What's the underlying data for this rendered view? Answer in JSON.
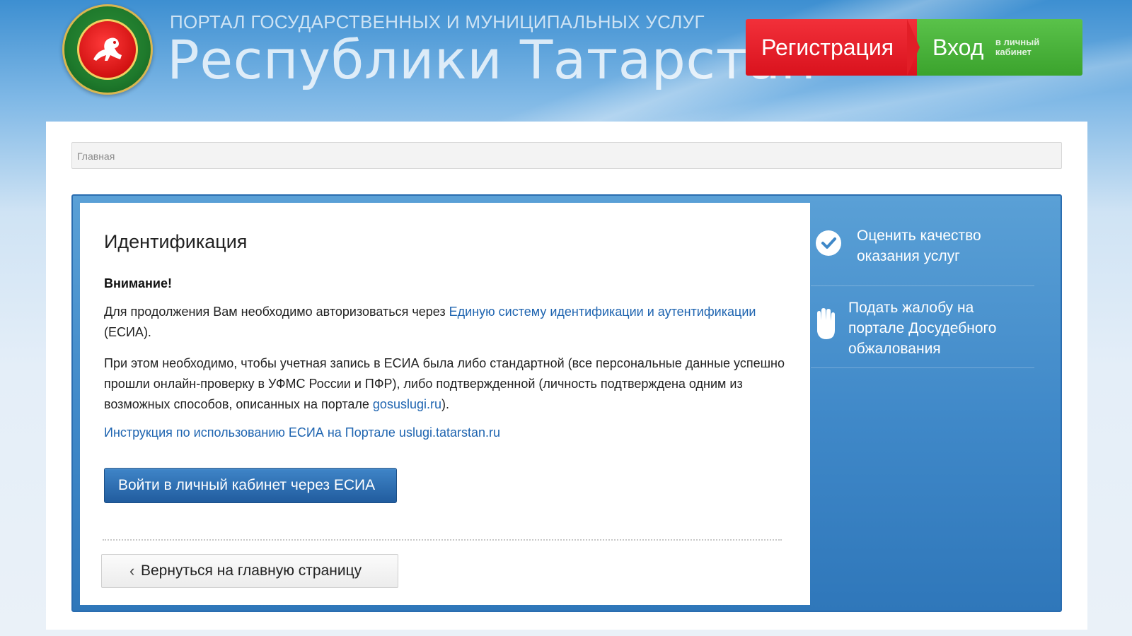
{
  "header": {
    "title_top": "ПОРТАЛ ГОСУДАРСТВЕННЫХ И МУНИЦИПАЛЬНЫХ УСЛУГ",
    "title_main": "Республики Татарстан",
    "emblem_icon": "tatarstan-emblem-icon",
    "register_label": "Регистрация",
    "login_label": "Вход",
    "login_sub": "в личный кабинет",
    "colors": {
      "register": "#e21e27",
      "login": "#4bb43c"
    }
  },
  "breadcrumb": {
    "home": "Главная"
  },
  "main": {
    "title": "Идентификация",
    "attention": "Внимание!",
    "p1_text": "Для продолжения Вам необходимо авторизоваться через ",
    "p1_link": "Единую систему идентификации и аутентификации",
    "p1_tail": " (ЕСИА).",
    "p2_text": "При этом необходимо, чтобы учетная запись в ЕСИА была либо стандартной (все персональные данные успешно прошли онлайн-проверку в УФМС России и ПФР), либо подтвержденной (личность подтверждена одним из возможных способов, описанных на портале ",
    "p2_link": "gosuslugi.ru",
    "p2_tail": ").",
    "instruction_link": "Инструкция по использованию ЕСИА на Портале uslugi.tatarstan.ru",
    "esia_button": "Войти в личный кабинет через ЕСИА",
    "back_button": "Вернуться на главную страницу"
  },
  "sidebar": {
    "items": [
      {
        "icon": "checkmark-circle-icon",
        "line1": "Оценить качество",
        "line2": "оказания услуг"
      },
      {
        "icon": "hand-stop-icon",
        "line1": "Подать жалобу на",
        "line2": "портале Досудебного",
        "line3": "обжалования"
      }
    ]
  }
}
